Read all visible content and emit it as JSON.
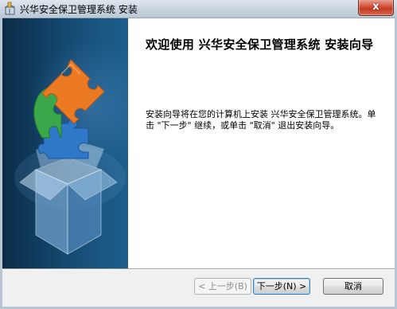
{
  "window": {
    "title": "兴华安全保卫管理系统 安装",
    "close_label": "x"
  },
  "welcome": {
    "title": "欢迎使用 兴华安全保卫管理系统 安装向导",
    "body": "安装向导将在您的计算机上安装 兴华安全保卫管理系统。单击 \"下一步\" 继续，或单击 \"取消\" 退出安装向导。"
  },
  "buttons": {
    "back_label": "< 上一步(B)",
    "next_label": "下一步(N) >",
    "cancel_label": "取消"
  },
  "icons": {
    "title": "installer-box-icon",
    "banner": "puzzle-box-graphic",
    "close": "close-icon"
  },
  "colors": {
    "banner_dark": "#0b2c47",
    "banner_light": "#1d5f8d",
    "close_red": "#c23b22",
    "next_focus": "#3c7fb1"
  }
}
